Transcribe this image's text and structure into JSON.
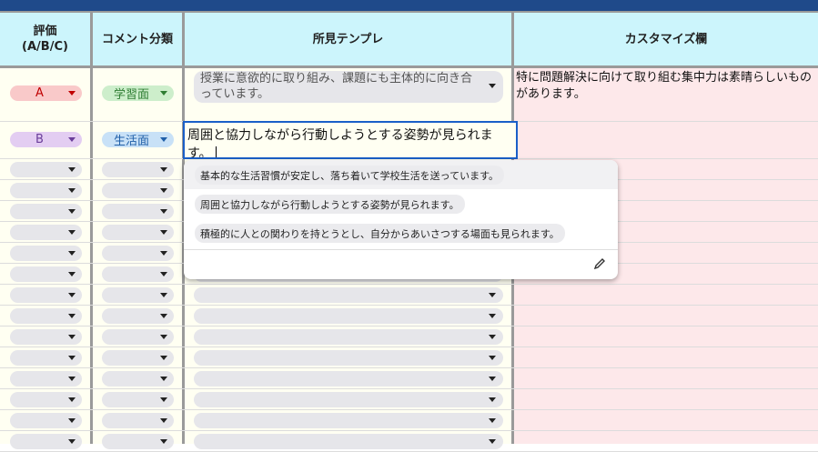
{
  "headers": {
    "rating": "評価\n(A/B/C)",
    "category": "コメント分類",
    "template": "所見テンプレ",
    "custom": "カスタマイズ欄"
  },
  "rows": [
    {
      "rating": "A",
      "rating_color": "#f9c9c9",
      "rating_text_color": "#c00000",
      "rating_arrow": "#c00000",
      "category": "学習面",
      "category_color": "#cdeecb",
      "category_text_color": "#2e7d32",
      "category_arrow": "#2e7d32",
      "template": "授業に意欲的に取り組み、課題にも主体的に向き合っています。",
      "custom": "特に問題解決に向けて取り組む集中力は素晴らしいものがあります。"
    },
    {
      "rating": "B",
      "rating_color": "#e3cdf2",
      "rating_text_color": "#6a3d9a",
      "rating_arrow": "#6a3d9a",
      "category": "生活面",
      "category_color": "#c8e1f7",
      "category_text_color": "#1f5fa8",
      "category_arrow": "#1f5fa8",
      "template": "周囲と協力しながら行動しようとする姿勢が見られます。",
      "custom": ""
    }
  ],
  "dropdown": {
    "options": [
      "基本的な生活習慣が安定し、落ち着いて学校生活を送っています。",
      "周囲と協力しながら行動しようとする姿勢が見られます。",
      "積極的に人との関わりを持とうとし、自分からあいさつする場面も見られます。"
    ],
    "edit_icon": "pencil-icon"
  }
}
